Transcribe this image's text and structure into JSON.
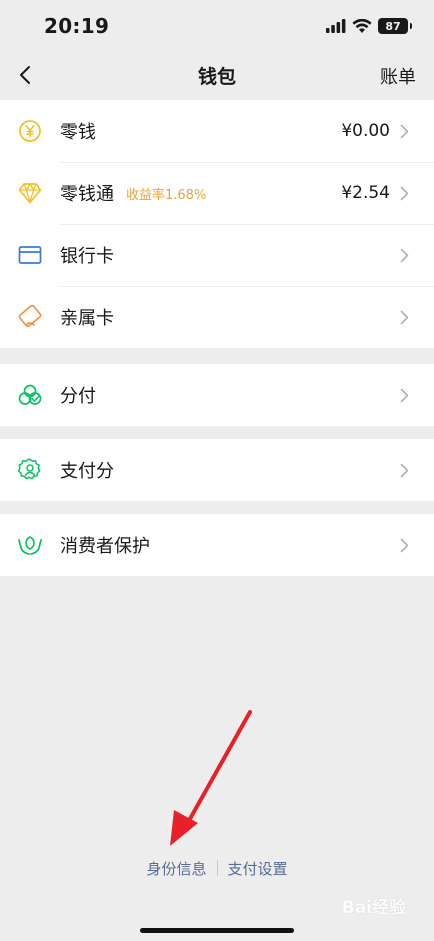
{
  "status_bar": {
    "time": "20:19",
    "battery": "87"
  },
  "nav": {
    "title": "钱包",
    "right_label": "账单"
  },
  "groups": [
    {
      "items": [
        {
          "label": "零钱",
          "value": "¥0.00",
          "icon": "coin-icon"
        },
        {
          "label": "零钱通",
          "tag": "收益率1.68%",
          "value": "¥2.54",
          "icon": "diamond-icon"
        },
        {
          "label": "银行卡",
          "icon": "bank-card-icon"
        },
        {
          "label": "亲属卡",
          "icon": "family-card-icon"
        }
      ]
    },
    {
      "items": [
        {
          "label": "分付",
          "icon": "fenfu-icon"
        }
      ]
    },
    {
      "items": [
        {
          "label": "支付分",
          "icon": "pay-score-icon"
        }
      ]
    },
    {
      "items": [
        {
          "label": "消费者保护",
          "icon": "consumer-protection-icon"
        }
      ]
    }
  ],
  "footer": {
    "identity": "身份信息",
    "payment_settings": "支付设置"
  },
  "watermark": "Bai经验",
  "colors": {
    "accent_green": "#07c160",
    "coin_yellow": "#f2c225",
    "card_blue": "#3b7ad9",
    "family_orange": "#f0944e",
    "tag_orange": "#e9a43c",
    "link_blue": "#576b95",
    "arrow_red": "#e8202a"
  }
}
